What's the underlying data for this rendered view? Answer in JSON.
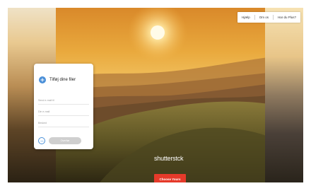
{
  "header": {
    "links": [
      "Hjælp",
      "Om os",
      "Har du Plus?"
    ]
  },
  "card": {
    "title": "Tilføj dine filer",
    "fields": [
      {
        "placeholder": "Send e-mail til"
      },
      {
        "placeholder": "Din e-mail"
      },
      {
        "placeholder": "Besked"
      }
    ],
    "transfer_label": "Overfør"
  },
  "brand": {
    "wordmark": "shutterst",
    "wordmark_tail": "ck"
  },
  "cta": {
    "label": "Choose Yours"
  },
  "colors": {
    "accent": "#4a8fd8",
    "cta": "#e53a2a"
  }
}
